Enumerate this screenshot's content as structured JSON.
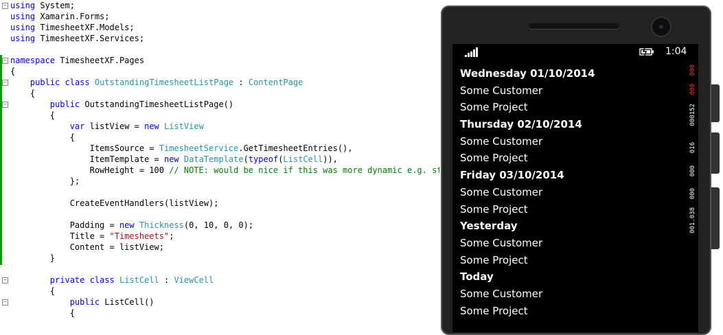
{
  "editor": {
    "lines": [
      {
        "fold": "minus",
        "segs": [
          {
            "c": "kw",
            "t": "using"
          },
          {
            "c": "",
            "t": " System;"
          }
        ]
      },
      {
        "fold": "",
        "segs": [
          {
            "c": "kw",
            "t": "using"
          },
          {
            "c": "",
            "t": " Xamarin.Forms;"
          }
        ]
      },
      {
        "fold": "",
        "segs": [
          {
            "c": "kw",
            "t": "using"
          },
          {
            "c": "",
            "t": " TimesheetXF.Models;"
          }
        ]
      },
      {
        "fold": "",
        "segs": [
          {
            "c": "kw",
            "t": "using"
          },
          {
            "c": "",
            "t": " TimesheetXF.Services;"
          }
        ]
      },
      {
        "fold": "",
        "segs": []
      },
      {
        "fold": "minus",
        "segs": [
          {
            "c": "kw",
            "t": "namespace"
          },
          {
            "c": "",
            "t": " TimesheetXF.Pages"
          }
        ]
      },
      {
        "fold": "",
        "segs": [
          {
            "c": "",
            "t": "{"
          }
        ]
      },
      {
        "fold": "minus",
        "segs": [
          {
            "c": "",
            "t": "    "
          },
          {
            "c": "kw",
            "t": "public"
          },
          {
            "c": "",
            "t": " "
          },
          {
            "c": "kw",
            "t": "class"
          },
          {
            "c": "",
            "t": " "
          },
          {
            "c": "ty",
            "t": "OutstandingTimesheetListPage"
          },
          {
            "c": "",
            "t": " : "
          },
          {
            "c": "ty",
            "t": "ContentPage"
          }
        ]
      },
      {
        "fold": "",
        "segs": [
          {
            "c": "",
            "t": "    {"
          }
        ]
      },
      {
        "fold": "minus",
        "segs": [
          {
            "c": "",
            "t": "        "
          },
          {
            "c": "kw",
            "t": "public"
          },
          {
            "c": "",
            "t": " OutstandingTimesheetListPage()"
          }
        ]
      },
      {
        "fold": "",
        "segs": [
          {
            "c": "",
            "t": "        {"
          }
        ]
      },
      {
        "fold": "",
        "segs": [
          {
            "c": "",
            "t": "            "
          },
          {
            "c": "kw",
            "t": "var"
          },
          {
            "c": "",
            "t": " listView = "
          },
          {
            "c": "kw",
            "t": "new"
          },
          {
            "c": "",
            "t": " "
          },
          {
            "c": "ty",
            "t": "ListView"
          }
        ]
      },
      {
        "fold": "",
        "segs": [
          {
            "c": "",
            "t": "            {"
          }
        ]
      },
      {
        "fold": "",
        "segs": [
          {
            "c": "",
            "t": "                ItemsSource = "
          },
          {
            "c": "ty",
            "t": "TimesheetService"
          },
          {
            "c": "",
            "t": ".GetTimesheetEntries(),"
          }
        ]
      },
      {
        "fold": "",
        "segs": [
          {
            "c": "",
            "t": "                ItemTemplate = "
          },
          {
            "c": "kw",
            "t": "new"
          },
          {
            "c": "",
            "t": " "
          },
          {
            "c": "ty",
            "t": "DataTemplate"
          },
          {
            "c": "",
            "t": "("
          },
          {
            "c": "kw",
            "t": "typeof"
          },
          {
            "c": "",
            "t": "("
          },
          {
            "c": "ty",
            "t": "ListCell"
          },
          {
            "c": "",
            "t": ")),"
          }
        ]
      },
      {
        "fold": "",
        "segs": [
          {
            "c": "",
            "t": "                RowHeight = 100 "
          },
          {
            "c": "cm",
            "t": "// NOTE: would be nice if this was more dynamic e.g. stac"
          }
        ]
      },
      {
        "fold": "",
        "segs": [
          {
            "c": "",
            "t": "            };"
          }
        ]
      },
      {
        "fold": "",
        "segs": []
      },
      {
        "fold": "",
        "segs": [
          {
            "c": "",
            "t": "            CreateEventHandlers(listView);"
          }
        ]
      },
      {
        "fold": "",
        "segs": []
      },
      {
        "fold": "",
        "segs": [
          {
            "c": "",
            "t": "            Padding = "
          },
          {
            "c": "kw",
            "t": "new"
          },
          {
            "c": "",
            "t": " "
          },
          {
            "c": "ty",
            "t": "Thickness"
          },
          {
            "c": "",
            "t": "(0, 10, 0, 0);"
          }
        ]
      },
      {
        "fold": "",
        "segs": [
          {
            "c": "",
            "t": "            Title = "
          },
          {
            "c": "st",
            "t": "\"Timesheets\""
          },
          {
            "c": "",
            "t": ";"
          }
        ]
      },
      {
        "fold": "",
        "segs": [
          {
            "c": "",
            "t": "            Content = listView;"
          }
        ]
      },
      {
        "fold": "",
        "segs": [
          {
            "c": "",
            "t": "        }"
          }
        ]
      },
      {
        "fold": "",
        "segs": []
      },
      {
        "fold": "minus",
        "segs": [
          {
            "c": "",
            "t": "        "
          },
          {
            "c": "kw",
            "t": "private"
          },
          {
            "c": "",
            "t": " "
          },
          {
            "c": "kw",
            "t": "class"
          },
          {
            "c": "",
            "t": " "
          },
          {
            "c": "ty",
            "t": "ListCell"
          },
          {
            "c": "",
            "t": " : "
          },
          {
            "c": "ty",
            "t": "ViewCell"
          }
        ]
      },
      {
        "fold": "",
        "segs": [
          {
            "c": "",
            "t": "        {"
          }
        ]
      },
      {
        "fold": "minus",
        "segs": [
          {
            "c": "",
            "t": "            "
          },
          {
            "c": "kw",
            "t": "public"
          },
          {
            "c": "",
            "t": " ListCell()"
          }
        ]
      },
      {
        "fold": "",
        "segs": [
          {
            "c": "",
            "t": "            {"
          }
        ]
      }
    ]
  },
  "phone": {
    "clock": "1:04",
    "signal_icon": "signal-bars-icon",
    "battery_icon": "battery-charging-icon",
    "entries": [
      {
        "date": "Wednesday 01/10/2014",
        "customer": "Some Customer",
        "project": "Some Project"
      },
      {
        "date": "Thursday 02/10/2014",
        "customer": "Some Customer",
        "project": "Some Project"
      },
      {
        "date": "Friday 03/10/2014",
        "customer": "Some Customer",
        "project": "Some Project"
      },
      {
        "date": "Yesterday",
        "customer": "Some Customer",
        "project": "Some Project"
      },
      {
        "date": "Today",
        "customer": "Some Customer",
        "project": "Some Project"
      }
    ],
    "frame_counters": [
      {
        "text": "000",
        "color": "red"
      },
      {
        "text": "000",
        "color": "red"
      },
      {
        "text": "000152",
        "color": "white"
      },
      {
        "text": "016",
        "color": "white"
      },
      {
        "text": "000",
        "color": "white"
      },
      {
        "text": "000",
        "color": "white"
      },
      {
        "text": "001.038",
        "color": "white"
      }
    ]
  },
  "colors": {
    "keyword": "#0000ff",
    "type": "#2b91af",
    "string": "#a31515",
    "comment": "#008000",
    "change_bar": "#00a000",
    "phone_bezel": "#222222",
    "screen": "#000000"
  }
}
